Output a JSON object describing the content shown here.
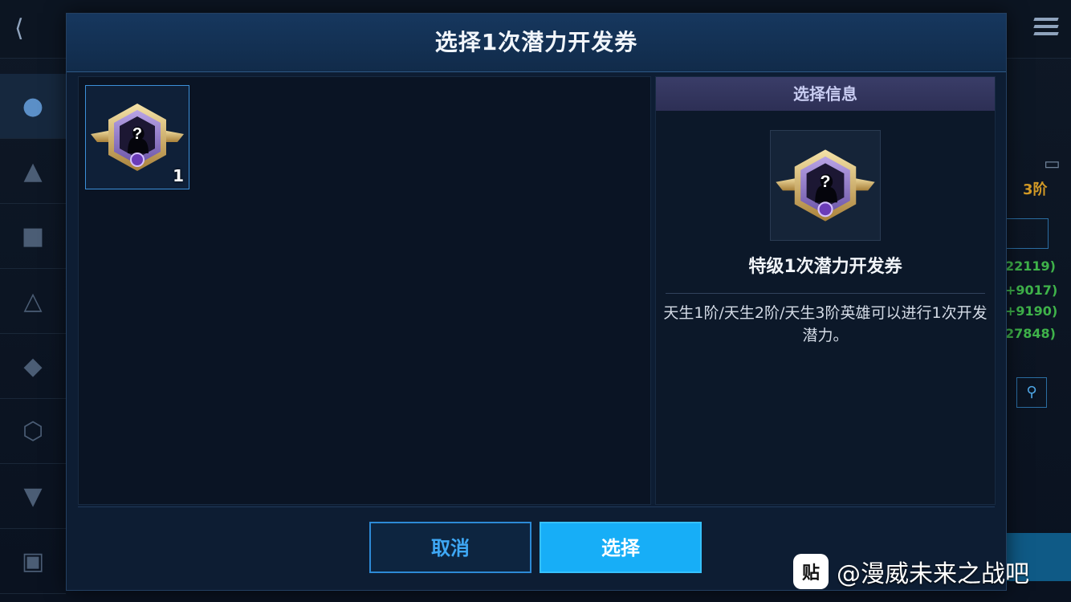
{
  "background": {
    "rank_label": "3阶",
    "stat_values": [
      "22119)",
      "+9017)",
      "+9190)",
      "27848)"
    ]
  },
  "dialog": {
    "title": "选择1次潜力开发券",
    "items": [
      {
        "icon": "potential-ticket-icon",
        "count": "1"
      }
    ],
    "info": {
      "header": "选择信息",
      "icon": "potential-ticket-icon",
      "name": "特级1次潜力开发券",
      "description": "天生1阶/天生2阶/天生3阶英雄可以进行1次开发潜力。"
    },
    "buttons": {
      "cancel": "取消",
      "select": "选择"
    }
  },
  "watermark": {
    "logo": "贴",
    "text": "@漫威未来之战吧"
  },
  "colors": {
    "accent": "#17aef7",
    "stat_green": "#3fb34a",
    "rank_gold": "#d39a26"
  }
}
